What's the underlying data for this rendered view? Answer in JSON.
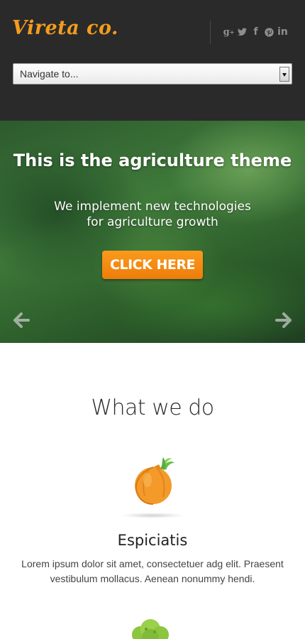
{
  "header": {
    "logo": "Vireta co.",
    "social_icons": [
      "google-plus-icon",
      "twitter-icon",
      "facebook-icon",
      "pinterest-icon",
      "linkedin-icon"
    ],
    "nav_select": "Navigate to..."
  },
  "hero": {
    "title": "This is the agriculture theme",
    "subtitle_line1": "We implement new technologies",
    "subtitle_line2": "for agriculture growth",
    "cta_label": "CLICK HERE"
  },
  "section": {
    "title": "What we do",
    "feature": {
      "icon": "onion-icon",
      "title": "Espiciatis",
      "text_line1": "Lorem ipsum dolor sit amet, consectetuer adg elit. Praesent",
      "text_line2": "vestibulum mollacus. Aenean nonummy hendi."
    },
    "next_icon": "broccoli-icon"
  },
  "colors": {
    "accent": "#f39c1e",
    "header_bg": "#2a2a2a",
    "cta_bg": "#f28c12"
  }
}
